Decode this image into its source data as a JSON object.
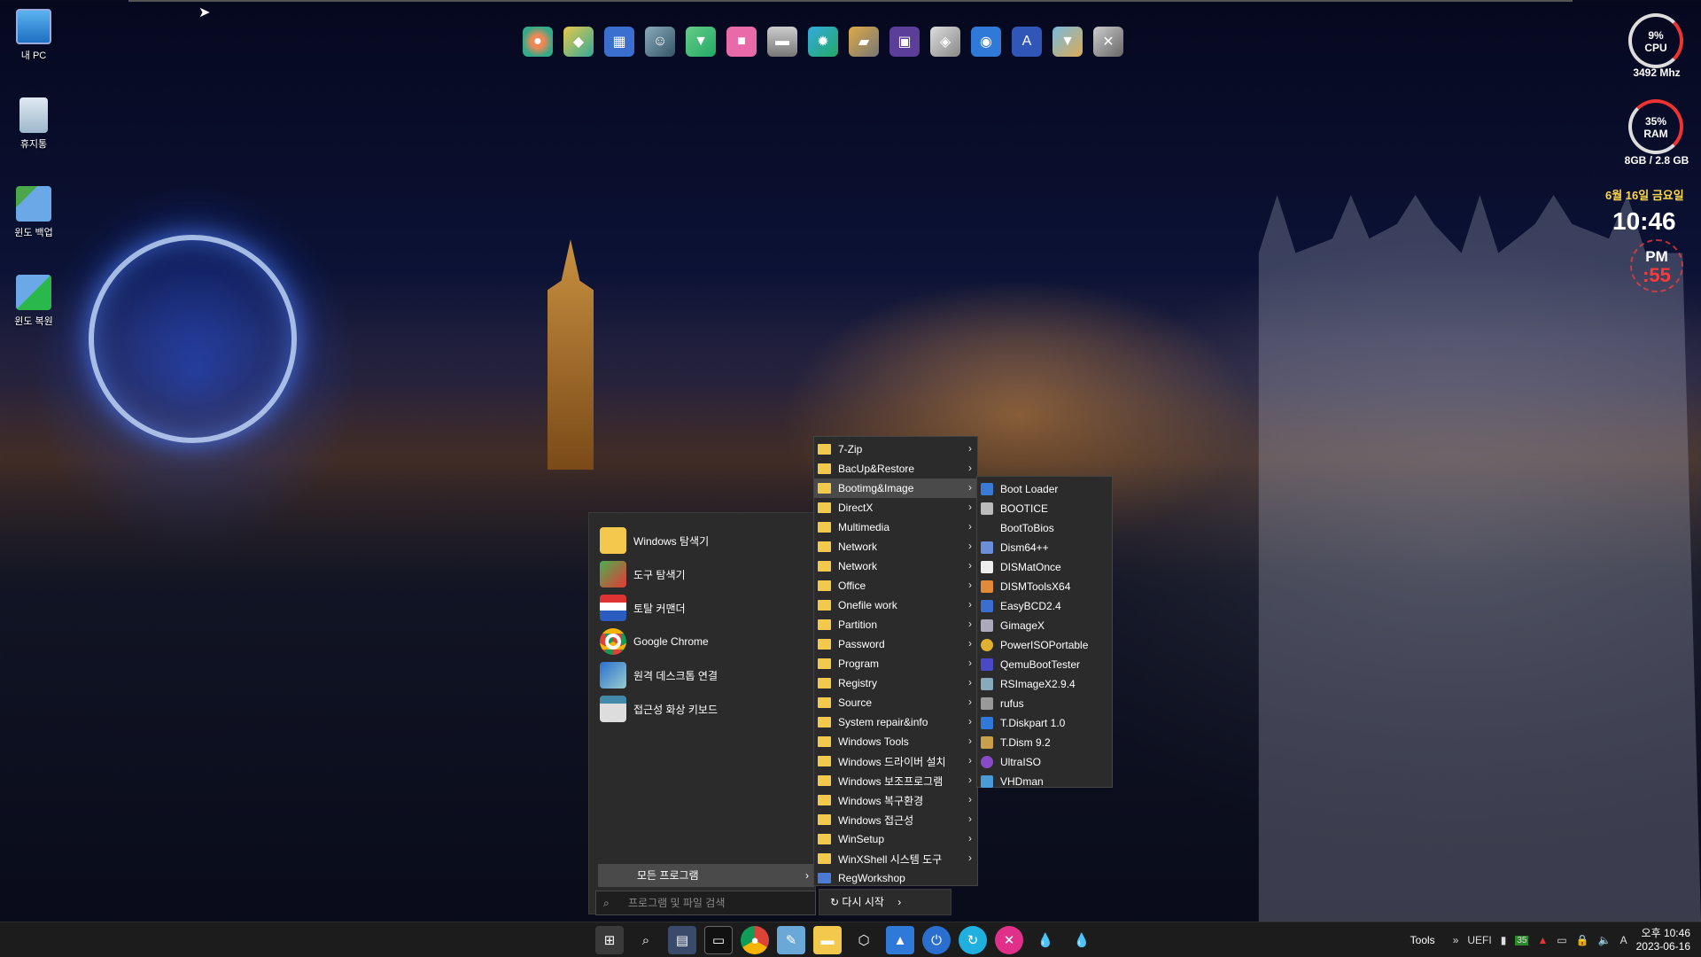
{
  "desktop_icons": [
    {
      "label": "내 PC"
    },
    {
      "label": "휴지통"
    },
    {
      "label": "윈도 백업"
    },
    {
      "label": "윈도 복원"
    }
  ],
  "dock_icons": [
    "disk-icon",
    "drive-icon",
    "windows-icon",
    "user-drive-icon",
    "install-icon",
    "erase-icon",
    "hdd-icon",
    "settings-disk-icon",
    "usb-drive-icon",
    "chip-icon",
    "eraser-icon",
    "install-disk-icon",
    "app-disk-icon",
    "install-icon-2",
    "tools-icon"
  ],
  "widgets": {
    "cpu": {
      "percent": "9%",
      "label": "CPU",
      "freq": "3492 Mhz"
    },
    "ram": {
      "percent": "35%",
      "label": "RAM",
      "size": "8GB /  2.8 GB"
    },
    "date": "6월 16일 금요일",
    "time": "10:46",
    "ampm": "PM",
    "seconds": ":55"
  },
  "start_menu": {
    "pinned": [
      {
        "label": "Windows 탐색기"
      },
      {
        "label": "도구 탐색기"
      },
      {
        "label": "토탈 커맨더"
      },
      {
        "label": "Google Chrome"
      },
      {
        "label": "원격 데스크톱 연결"
      },
      {
        "label": "접근성 화상 키보드"
      }
    ],
    "all_programs": "모든 프로그램",
    "search_placeholder": "프로그램 및 파일 검색",
    "restart": "다시 시작"
  },
  "programs_menu": [
    "7-Zip",
    "BacUp&Restore",
    "Bootimg&Image",
    "DirectX",
    "Multimedia",
    "Network",
    "Network",
    "Office",
    "Onefile work",
    "Partition",
    "Password",
    "Program",
    "Registry",
    "Source",
    "System repair&info",
    "Windows Tools",
    "Windows 드라이버 설치",
    "Windows 보조프로그램",
    "Windows 복구환경",
    "Windows 접근성",
    "WinSetup",
    "WinXShell 시스템 도구",
    "RegWorkshop"
  ],
  "boot_menu": [
    "Boot Loader",
    "BOOTICE",
    "BootToBios",
    "Dism64++",
    "DISMatOnce",
    "DISMToolsX64",
    "EasyBCD2.4",
    "GimageX",
    "PowerISOPortable",
    "QemuBootTester",
    "RSImageX2.9.4",
    "rufus",
    "T.Diskpart 1.0",
    "T.Dism 9.2",
    "UltraISO",
    "VHDman"
  ],
  "taskbar": {
    "tools": "Tools",
    "uefi": "UEFI",
    "badge": "35",
    "ime": "A",
    "clock_time": "오후 10:46",
    "clock_date": "2023-06-16"
  }
}
